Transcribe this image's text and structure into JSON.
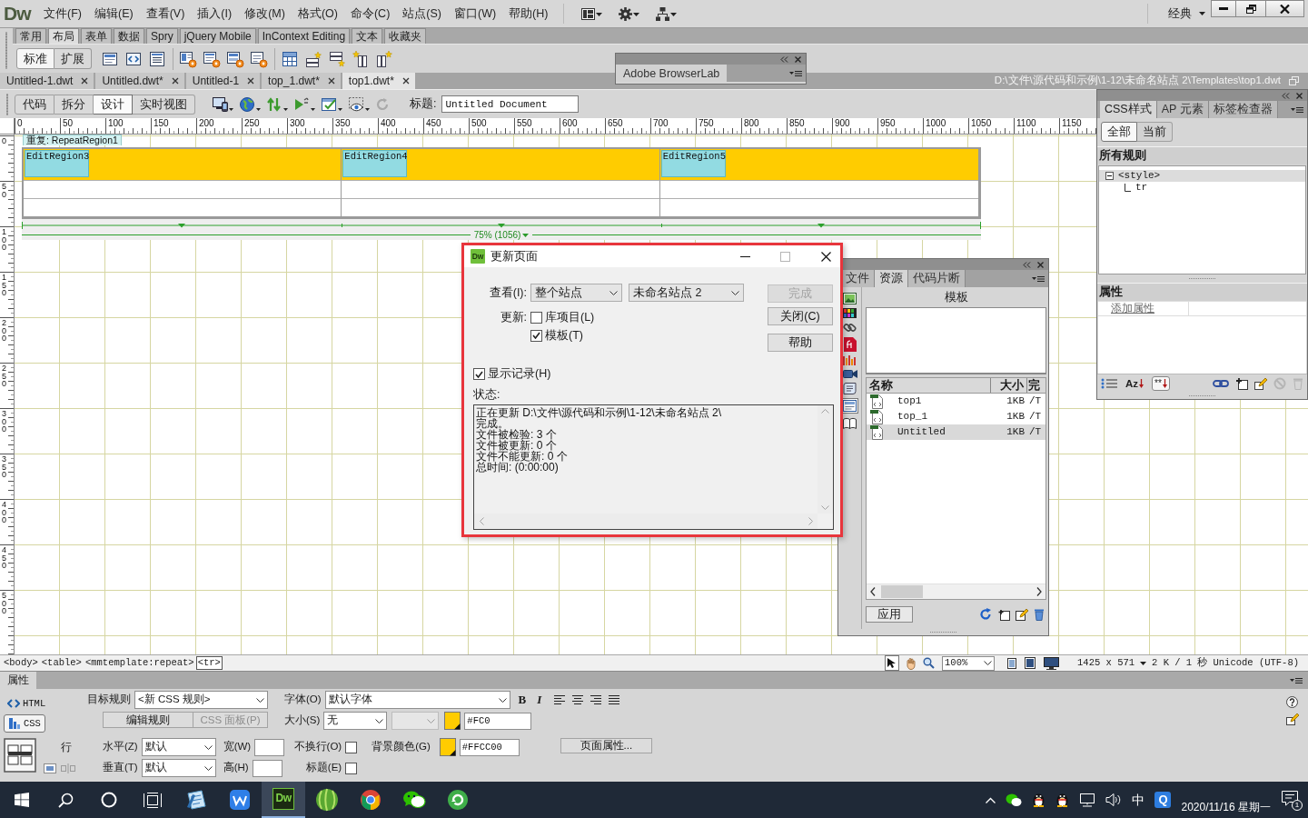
{
  "app": {
    "logo": "Dw",
    "menus": [
      "文件(F)",
      "编辑(E)",
      "查看(V)",
      "插入(I)",
      "修改(M)",
      "格式(O)",
      "命令(C)",
      "站点(S)",
      "窗口(W)",
      "帮助(H)"
    ],
    "workspace": "经典"
  },
  "insert_panel": {
    "tabs": [
      {
        "label": "常用",
        "selected": false
      },
      {
        "label": "布局",
        "selected": true
      },
      {
        "label": "表单",
        "selected": false
      },
      {
        "label": "数据",
        "selected": false
      },
      {
        "label": "Spry",
        "selected": false
      },
      {
        "label": "jQuery Mobile",
        "selected": false
      },
      {
        "label": "InContext Editing",
        "selected": false
      },
      {
        "label": "文本",
        "selected": false
      },
      {
        "label": "收藏夹",
        "selected": false
      }
    ],
    "modes": [
      {
        "label": "标准",
        "selected": true
      },
      {
        "label": "扩展",
        "selected": false
      }
    ]
  },
  "browserlab_panel": {
    "tab": "Adobe BrowserLab"
  },
  "document_tabs": [
    {
      "label": "Untitled-1.dwt",
      "selected": false
    },
    {
      "label": "Untitled.dwt*",
      "selected": false
    },
    {
      "label": "Untitled-1",
      "selected": false
    },
    {
      "label": "top_1.dwt*",
      "selected": false
    },
    {
      "label": "top1.dwt*",
      "selected": true
    }
  ],
  "document_path": "D:\\文件\\源代码和示例\\1-12\\未命名站点 2\\Templates\\top1.dwt",
  "document_toolbar": {
    "views": [
      {
        "label": "代码",
        "selected": false
      },
      {
        "label": "拆分",
        "selected": false
      },
      {
        "label": "设计",
        "selected": true
      },
      {
        "label": "实时视图",
        "selected": false
      }
    ],
    "title_label": "标题:",
    "title_value": "Untitled Document"
  },
  "rulers": {
    "x_labels": [
      "0",
      "50",
      "100",
      "150",
      "200",
      "250",
      "300",
      "350",
      "400",
      "450",
      "500",
      "550",
      "600",
      "650",
      "700",
      "750",
      "800",
      "850",
      "900",
      "950",
      "1000",
      "1050",
      "1100",
      "1150"
    ],
    "y_labels": [
      "0",
      "50",
      "100",
      "150",
      "200",
      "250",
      "300",
      "350",
      "400",
      "450",
      "500"
    ]
  },
  "design_view": {
    "repeat_label": "重复: RepeatRegion1",
    "editable_regions": [
      "EditRegion3",
      "EditRegion4",
      "EditRegion5"
    ],
    "table_width": "75% (1056)"
  },
  "update_dialog": {
    "title_icon": "Dw",
    "title": "更新页面",
    "look_in_label": "查看(I):",
    "look_in": "整个站点",
    "site": "未命名站点 2",
    "update_label": "更新:",
    "update_options": [
      {
        "label": "库项目(L)",
        "checked": false
      },
      {
        "label": "模板(T)",
        "checked": true
      }
    ],
    "show_log": {
      "label": "显示记录(H)",
      "checked": true
    },
    "status_label": "状态:",
    "log": [
      "正在更新 D:\\文件\\源代码和示例\\1-12\\未命名站点 2\\",
      "完成。",
      "文件被检验: 3 个",
      "文件被更新: 0 个",
      "文件不能更新: 0 个",
      "总时间: (0:00:00)"
    ],
    "buttons": [
      {
        "label": "完成",
        "disabled": true
      },
      {
        "label": "关闭(C)",
        "disabled": false
      },
      {
        "label": "帮助",
        "disabled": false
      }
    ]
  },
  "assets_panel": {
    "tabs": [
      {
        "label": "文件",
        "selected": false
      },
      {
        "label": "资源",
        "selected": true
      },
      {
        "label": "代码片断",
        "selected": false
      }
    ],
    "categories": [
      {
        "kind": "images",
        "selected": false
      },
      {
        "kind": "colors",
        "selected": false
      },
      {
        "kind": "urls",
        "selected": false
      },
      {
        "kind": "flash",
        "selected": false
      },
      {
        "kind": "shockwave",
        "selected": false
      },
      {
        "kind": "movies",
        "selected": false
      },
      {
        "kind": "scripts",
        "selected": false
      },
      {
        "kind": "templates",
        "selected": true
      },
      {
        "kind": "library",
        "selected": false
      }
    ],
    "title": "模板",
    "columns": [
      "名称",
      "大小",
      "完"
    ],
    "rows": [
      {
        "name": "top1",
        "size": "1KB",
        "path": "/T",
        "selected": false
      },
      {
        "name": "top_1",
        "size": "1KB",
        "path": "/T",
        "selected": false
      },
      {
        "name": "Untitled",
        "size": "1KB",
        "path": "/T",
        "selected": true
      }
    ],
    "apply": "应用"
  },
  "css_panel": {
    "tabs": [
      {
        "label": "CSS样式",
        "selected": true
      },
      {
        "label": "AP 元素",
        "selected": false
      },
      {
        "label": "标签检查器",
        "selected": false
      }
    ],
    "modes": [
      {
        "label": "全部",
        "selected": true
      },
      {
        "label": "当前",
        "selected": false
      }
    ],
    "rules_title": "所有规则",
    "rules": [
      {
        "label": "<style>",
        "selected": true,
        "expanded": true,
        "children": [
          {
            "label": "tr",
            "selected": false
          }
        ]
      }
    ],
    "properties_title": "属性",
    "add_property": "添加属性",
    "views": [
      {
        "kind": "category",
        "selected": false
      },
      {
        "kind": "alphabetical",
        "label": "Az",
        "selected": false
      },
      {
        "kind": "set",
        "label": "**",
        "selected": true
      }
    ]
  },
  "status_bar": {
    "tags": [
      {
        "label": "<body>",
        "selected": false
      },
      {
        "label": "<table>",
        "selected": false
      },
      {
        "label": "<mmtemplate:repeat>",
        "selected": false
      },
      {
        "label": "<tr>",
        "selected": true
      }
    ],
    "tools": [
      {
        "kind": "pointer",
        "selected": true
      },
      {
        "kind": "hand",
        "selected": false
      },
      {
        "kind": "zoom",
        "selected": false
      }
    ],
    "zoom": "100%",
    "window_size": "1425 x 571",
    "download": "2 K / 1 秒",
    "encoding": "Unicode (UTF-8)"
  },
  "properties": {
    "title": "属性",
    "modes": [
      {
        "kind": "html",
        "label": "HTML",
        "selected": false
      },
      {
        "kind": "css",
        "label": "CSS",
        "selected": true
      }
    ],
    "target_rule_label": "目标规则",
    "target_rule": "<新 CSS 规则>",
    "buttons": [
      {
        "label": "编辑规则",
        "disabled": false
      },
      {
        "label": "CSS 面板(P)",
        "disabled": true
      }
    ],
    "font_label": "字体(O)",
    "font": "默认字体",
    "styles": [
      "B",
      "I"
    ],
    "size_label": "大小(S)",
    "size": "无",
    "text_color": "#FC0",
    "row_label": "行",
    "horizontal_label": "水平(Z)",
    "horizontal": "默认",
    "vertical_label": "垂直(T)",
    "vertical": "默认",
    "width_label": "宽(W)",
    "height_label": "高(H)",
    "nowrap": {
      "label": "不换行(O)",
      "checked": false
    },
    "header": {
      "label": "标题(E)",
      "checked": false
    },
    "bg_label": "背景颜色(G)",
    "bg_color": "#FFCC00",
    "page_properties": "页面属性..."
  },
  "taskbar": {
    "apps": [
      {
        "kind": "notes",
        "active": false
      },
      {
        "kind": "writer",
        "active": false
      },
      {
        "kind": "dw",
        "label": "Dw",
        "active": true
      },
      {
        "kind": "ball",
        "active": false
      },
      {
        "kind": "browser",
        "active": false
      },
      {
        "kind": "chat",
        "active": false
      },
      {
        "kind": "circle",
        "active": false
      }
    ],
    "ime": "中",
    "tray_app": "Q",
    "date": "2020/11/16 星期一",
    "notifications": "1"
  }
}
